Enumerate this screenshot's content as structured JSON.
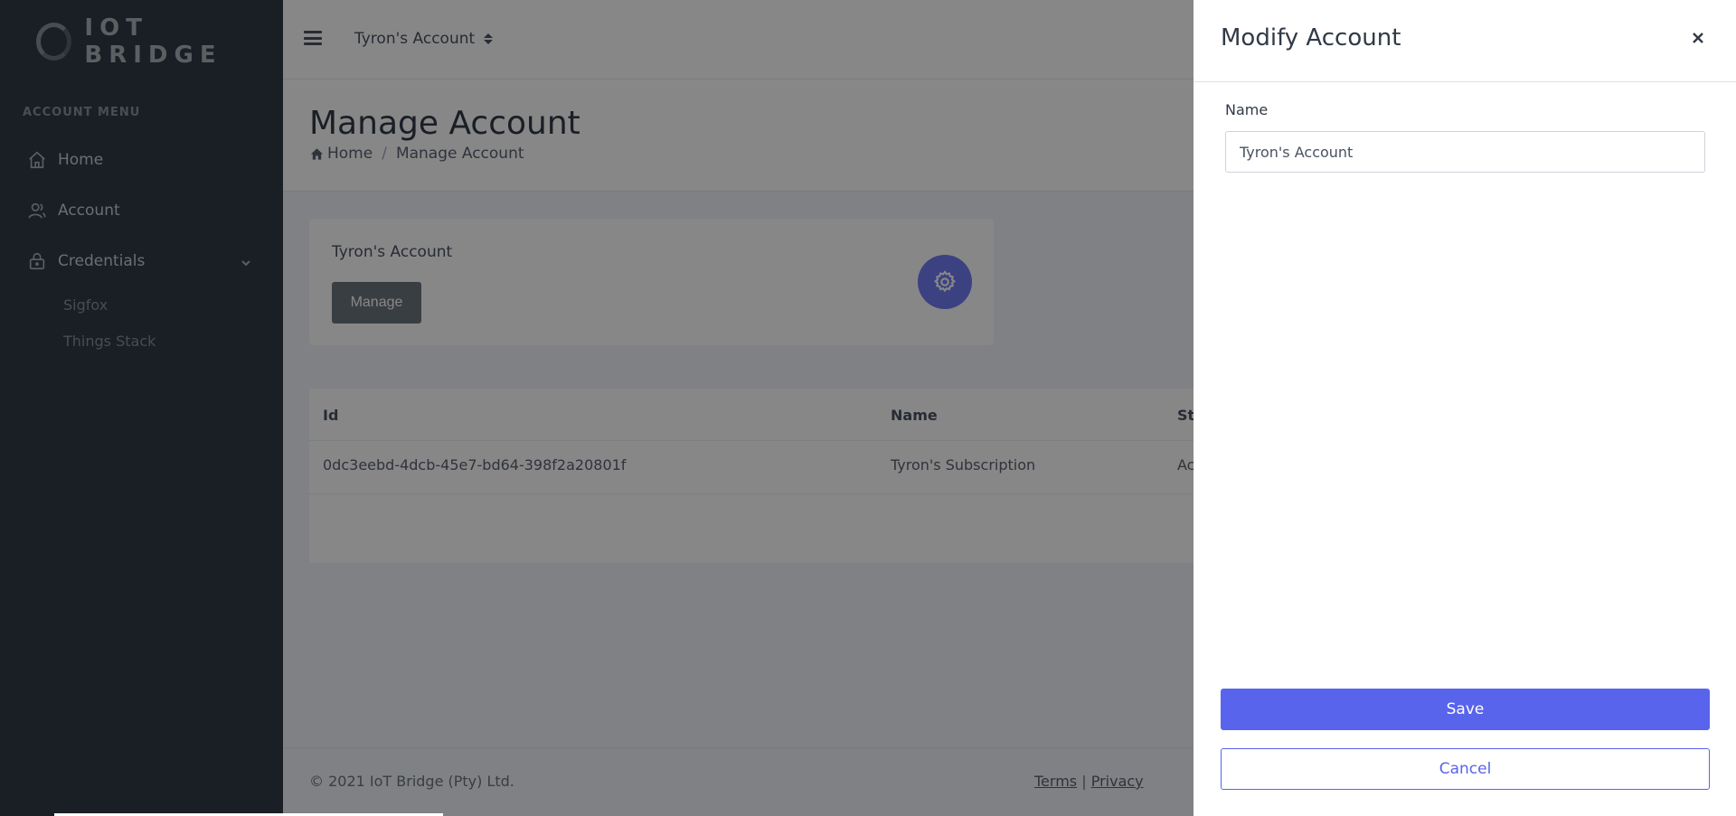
{
  "brand": {
    "name": "IOT BRIDGE"
  },
  "sidebar": {
    "menu_title": "ACCOUNT MENU",
    "items": [
      {
        "label": "Home",
        "icon": "home-icon"
      },
      {
        "label": "Account",
        "icon": "user-icon"
      },
      {
        "label": "Credentials",
        "icon": "lock-icon"
      }
    ],
    "credentials_children": [
      {
        "label": "Sigfox"
      },
      {
        "label": "Things Stack"
      }
    ]
  },
  "topbar": {
    "account_selected": "Tyron's Account"
  },
  "page": {
    "title": "Manage Account",
    "breadcrumb": {
      "home": "Home",
      "current": "Manage Account"
    }
  },
  "account_card": {
    "title": "Tyron's Account",
    "manage_label": "Manage"
  },
  "table": {
    "headers": [
      "Id",
      "Name",
      "St"
    ],
    "rows": [
      [
        "0dc3eebd-4dcb-45e7-bd64-398f2a20801f",
        "Tyron's Subscription",
        "Ac"
      ]
    ]
  },
  "footer": {
    "copyright": "© 2021 IoT Bridge (Pty) Ltd.",
    "terms": "Terms",
    "separator": "|",
    "privacy": "Privacy"
  },
  "modal": {
    "title": "Modify Account",
    "name_label": "Name",
    "name_value": "Tyron's Account",
    "save_label": "Save",
    "cancel_label": "Cancel"
  },
  "colors": {
    "primary": "#5864ec",
    "sidebar": "#313a46",
    "gear_badge": "#727cf5"
  }
}
